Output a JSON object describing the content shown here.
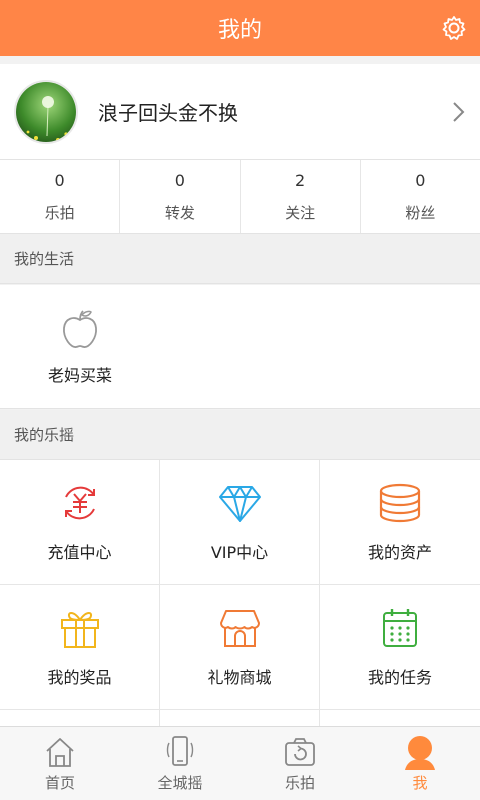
{
  "header": {
    "title": "我的",
    "icon": "gear-icon"
  },
  "profile": {
    "username": "浪子回头金不换",
    "avatar_icon": "dandelion-avatar"
  },
  "stats": [
    {
      "value": "0",
      "label": "乐拍"
    },
    {
      "value": "0",
      "label": "转发"
    },
    {
      "value": "2",
      "label": "关注"
    },
    {
      "value": "0",
      "label": "粉丝"
    }
  ],
  "section_life": {
    "title": "我的生活",
    "items": [
      {
        "label": "老妈买菜",
        "icon": "apple-icon"
      }
    ]
  },
  "section_yao": {
    "title": "我的乐摇",
    "items": [
      {
        "label": "充值中心",
        "icon": "yuan-recharge-icon",
        "color": "#e53a3a"
      },
      {
        "label": "VIP中心",
        "icon": "diamond-icon",
        "color": "#2aa8e6"
      },
      {
        "label": "我的资产",
        "icon": "coin-stack-icon",
        "color": "#f07a35"
      },
      {
        "label": "我的奖品",
        "icon": "gift-icon",
        "color": "#f2b51c"
      },
      {
        "label": "礼物商城",
        "icon": "shop-icon",
        "color": "#f07a35"
      },
      {
        "label": "我的任务",
        "icon": "calendar-icon",
        "color": "#3fae3f"
      }
    ]
  },
  "tabbar": [
    {
      "label": "首页",
      "icon": "home-icon",
      "active": false
    },
    {
      "label": "全城摇",
      "icon": "phone-shake-icon",
      "active": false
    },
    {
      "label": "乐拍",
      "icon": "camera-icon",
      "active": false
    },
    {
      "label": "我",
      "icon": "person-icon",
      "active": true
    }
  ],
  "colors": {
    "accent": "#ff8547",
    "active_tab": "#ff8a3c"
  }
}
